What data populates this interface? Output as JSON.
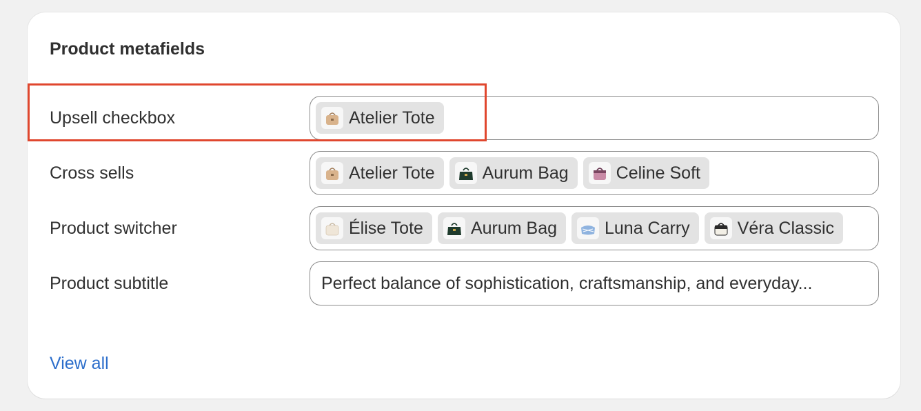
{
  "card": {
    "title": "Product metafields",
    "view_all": "View all"
  },
  "rows": [
    {
      "label": "Upsell checkbox",
      "products": [
        {
          "name": "Atelier Tote",
          "icon": "tan-handbag-icon"
        }
      ]
    },
    {
      "label": "Cross sells",
      "products": [
        {
          "name": "Atelier Tote",
          "icon": "tan-handbag-icon"
        },
        {
          "name": "Aurum Bag",
          "icon": "green-handbag-icon"
        },
        {
          "name": "Celine Soft",
          "icon": "pink-handbag-icon"
        }
      ]
    },
    {
      "label": "Product switcher",
      "products": [
        {
          "name": "Élise Tote",
          "icon": "cream-handbag-icon"
        },
        {
          "name": "Aurum Bag",
          "icon": "green-handbag-icon"
        },
        {
          "name": "Luna Carry",
          "icon": "blue-bag-icon"
        },
        {
          "name": "Véra Classic",
          "icon": "black-white-handbag-icon"
        }
      ]
    },
    {
      "label": "Product subtitle",
      "text": "Perfect balance of sophistication, craftsmanship, and everyday..."
    }
  ],
  "colors": {
    "highlight": "#e0472e",
    "link": "#2c6ecb",
    "tan": "#d9b38c",
    "green": "#1f3b2d",
    "pink": "#c98aa6",
    "cream": "#efe6d8",
    "blue": "#8fb3df",
    "black": "#2a2a2a"
  }
}
